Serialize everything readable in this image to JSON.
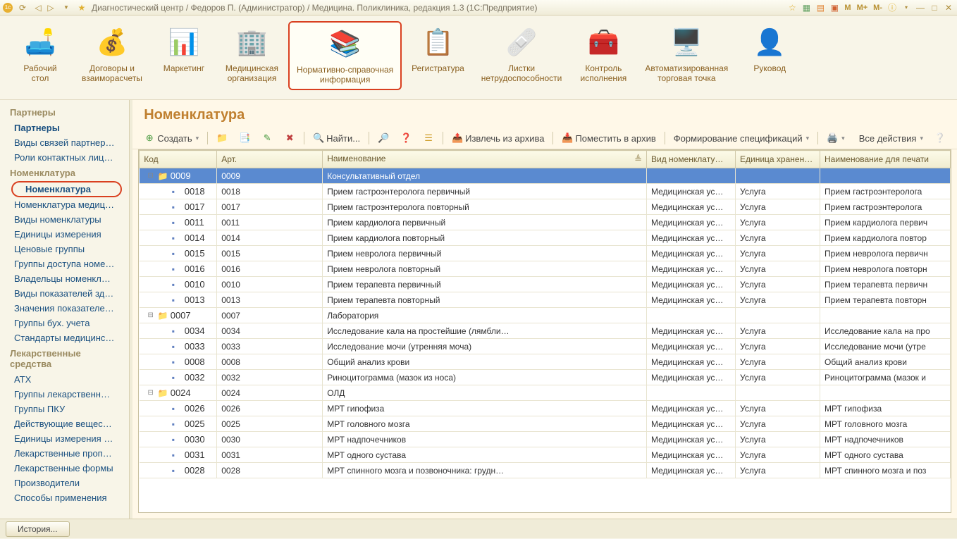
{
  "titlebar": {
    "text": "Диагностический центр / Федоров П. (Администратор) / Медицина. Поликлиника, редакция 1.3  (1С:Предприятие)",
    "memo": [
      "M",
      "M+",
      "M-"
    ]
  },
  "sections": [
    {
      "id": "desk",
      "label": "Рабочий\nстол",
      "emoji": "🛋️"
    },
    {
      "id": "contracts",
      "label": "Договоры и\nвзаиморасчеты",
      "emoji": "💰"
    },
    {
      "id": "marketing",
      "label": "Маркетинг",
      "emoji": "📊"
    },
    {
      "id": "medorg",
      "label": "Медицинская\nорганизация",
      "emoji": "🏢"
    },
    {
      "id": "nsi",
      "label": "Нормативно-справочная\nинформация",
      "emoji": "📚",
      "active": true
    },
    {
      "id": "reg",
      "label": "Регистратура",
      "emoji": "📋"
    },
    {
      "id": "sick",
      "label": "Листки\nнетрудоспособности",
      "emoji": "🩹"
    },
    {
      "id": "control",
      "label": "Контроль\nисполнения",
      "emoji": "🧰"
    },
    {
      "id": "pos",
      "label": "Автоматизированная\nторговая точка",
      "emoji": "🖥️"
    },
    {
      "id": "mgr",
      "label": "Руковод",
      "emoji": "👤"
    }
  ],
  "leftnav": {
    "groups": [
      {
        "header": "Партнеры",
        "items": [
          {
            "label": "Партнеры",
            "bold": true
          },
          {
            "label": "Виды связей партнеров"
          },
          {
            "label": "Роли контактных лиц партнеров"
          }
        ]
      },
      {
        "header": "Номенклатура",
        "items": [
          {
            "label": "Номенклатура",
            "highlighted": true
          },
          {
            "label": "Номенклатура медицинских усл…"
          },
          {
            "label": "Виды номенклатуры"
          },
          {
            "label": "Единицы измерения"
          },
          {
            "label": "Ценовые группы"
          },
          {
            "label": "Группы доступа номенклатуры"
          },
          {
            "label": "Владельцы номенклатуры"
          },
          {
            "label": "Виды показателей здоровья"
          },
          {
            "label": "Значения показателей здоровья"
          },
          {
            "label": "Группы бух. учета"
          },
          {
            "label": "Стандарты медицинской помощи"
          }
        ]
      },
      {
        "header": "Лекарственные средства",
        "items": [
          {
            "label": "АТХ"
          },
          {
            "label": "Группы лекарственных форм"
          },
          {
            "label": "Группы ПКУ"
          },
          {
            "label": "Действующие вещества (МНН)"
          },
          {
            "label": "Единицы измерения лекарстве…"
          },
          {
            "label": "Лекарственные прописи"
          },
          {
            "label": "Лекарственные формы"
          },
          {
            "label": "Производители"
          },
          {
            "label": "Способы применения"
          }
        ]
      }
    ]
  },
  "page_title": "Номенклатура",
  "toolbar": {
    "create": "Создать",
    "find": "Найти...",
    "extract": "Извлечь из архива",
    "archive": "Поместить в архив",
    "specs": "Формирование спецификаций",
    "all_actions": "Все действия"
  },
  "table": {
    "columns": [
      "Код",
      "Арт.",
      "Наименование",
      "Вид номенклату…",
      "Единица хранен…",
      "Наименование для печати"
    ],
    "rows": [
      {
        "indent": 0,
        "folder": true,
        "open": true,
        "code": "0009",
        "art": "0009",
        "name": "Консультативный отдел",
        "type": "",
        "unit": "",
        "print": "",
        "selected": true
      },
      {
        "indent": 1,
        "code": "0018",
        "art": "0018",
        "name": "Прием гастроэнтеролога первичный",
        "type": "Медицинская ус…",
        "unit": "Услуга",
        "print": "Прием гастроэнтеролога"
      },
      {
        "indent": 1,
        "code": "0017",
        "art": "0017",
        "name": "Прием гастроэнтеролога повторный",
        "type": "Медицинская ус…",
        "unit": "Услуга",
        "print": "Прием гастроэнтеролога"
      },
      {
        "indent": 1,
        "code": "0011",
        "art": "0011",
        "name": "Прием кардиолога первичный",
        "type": "Медицинская ус…",
        "unit": "Услуга",
        "print": "Прием кардиолога первич"
      },
      {
        "indent": 1,
        "code": "0014",
        "art": "0014",
        "name": "Прием кардиолога повторный",
        "type": "Медицинская ус…",
        "unit": "Услуга",
        "print": "Прием кардиолога повтор"
      },
      {
        "indent": 1,
        "code": "0015",
        "art": "0015",
        "name": "Прием невролога первичный",
        "type": "Медицинская ус…",
        "unit": "Услуга",
        "print": "Прием невролога первичн"
      },
      {
        "indent": 1,
        "code": "0016",
        "art": "0016",
        "name": "Прием невролога повторный",
        "type": "Медицинская ус…",
        "unit": "Услуга",
        "print": "Прием невролога повторн"
      },
      {
        "indent": 1,
        "code": "0010",
        "art": "0010",
        "name": "Прием терапевта первичный",
        "type": "Медицинская ус…",
        "unit": "Услуга",
        "print": "Прием терапевта первичн"
      },
      {
        "indent": 1,
        "code": "0013",
        "art": "0013",
        "name": "Прием терапевта повторный",
        "type": "Медицинская ус…",
        "unit": "Услуга",
        "print": "Прием терапевта повторн"
      },
      {
        "indent": 0,
        "folder": true,
        "open": true,
        "code": "0007",
        "art": "0007",
        "name": "Лаборатория",
        "type": "",
        "unit": "",
        "print": ""
      },
      {
        "indent": 1,
        "code": "0034",
        "art": "0034",
        "name": "Исследование кала на простейшие (лямбли…",
        "type": "Медицинская ус…",
        "unit": "Услуга",
        "print": "Исследование кала на про"
      },
      {
        "indent": 1,
        "code": "0033",
        "art": "0033",
        "name": "Исследование мочи (утренняя моча)",
        "type": "Медицинская ус…",
        "unit": "Услуга",
        "print": "Исследование мочи (утре"
      },
      {
        "indent": 1,
        "code": "0008",
        "art": "0008",
        "name": "Общий анализ крови",
        "type": "Медицинская ус…",
        "unit": "Услуга",
        "print": "Общий анализ крови"
      },
      {
        "indent": 1,
        "code": "0032",
        "art": "0032",
        "name": "Риноцитограмма (мазок из носа)",
        "type": "Медицинская ус…",
        "unit": "Услуга",
        "print": "Риноцитограмма (мазок и"
      },
      {
        "indent": 0,
        "folder": true,
        "open": true,
        "code": "0024",
        "art": "0024",
        "name": "ОЛД",
        "type": "",
        "unit": "",
        "print": ""
      },
      {
        "indent": 1,
        "code": "0026",
        "art": "0026",
        "name": "МРТ гипофиза",
        "type": "Медицинская ус…",
        "unit": "Услуга",
        "print": "МРТ гипофиза"
      },
      {
        "indent": 1,
        "code": "0025",
        "art": "0025",
        "name": "МРТ головного мозга",
        "type": "Медицинская ус…",
        "unit": "Услуга",
        "print": "МРТ головного мозга"
      },
      {
        "indent": 1,
        "code": "0030",
        "art": "0030",
        "name": "МРТ надпочечников",
        "type": "Медицинская ус…",
        "unit": "Услуга",
        "print": "МРТ надпочечников"
      },
      {
        "indent": 1,
        "code": "0031",
        "art": "0031",
        "name": "МРТ одного сустава",
        "type": "Медицинская ус…",
        "unit": "Услуга",
        "print": "МРТ одного сустава"
      },
      {
        "indent": 1,
        "code": "0028",
        "art": "0028",
        "name": "МРТ спинного мозга и позвоночника: грудн…",
        "type": "Медицинская ус…",
        "unit": "Услуга",
        "print": "МРТ спинного мозга и поз"
      }
    ]
  },
  "bottom": {
    "history": "История..."
  }
}
